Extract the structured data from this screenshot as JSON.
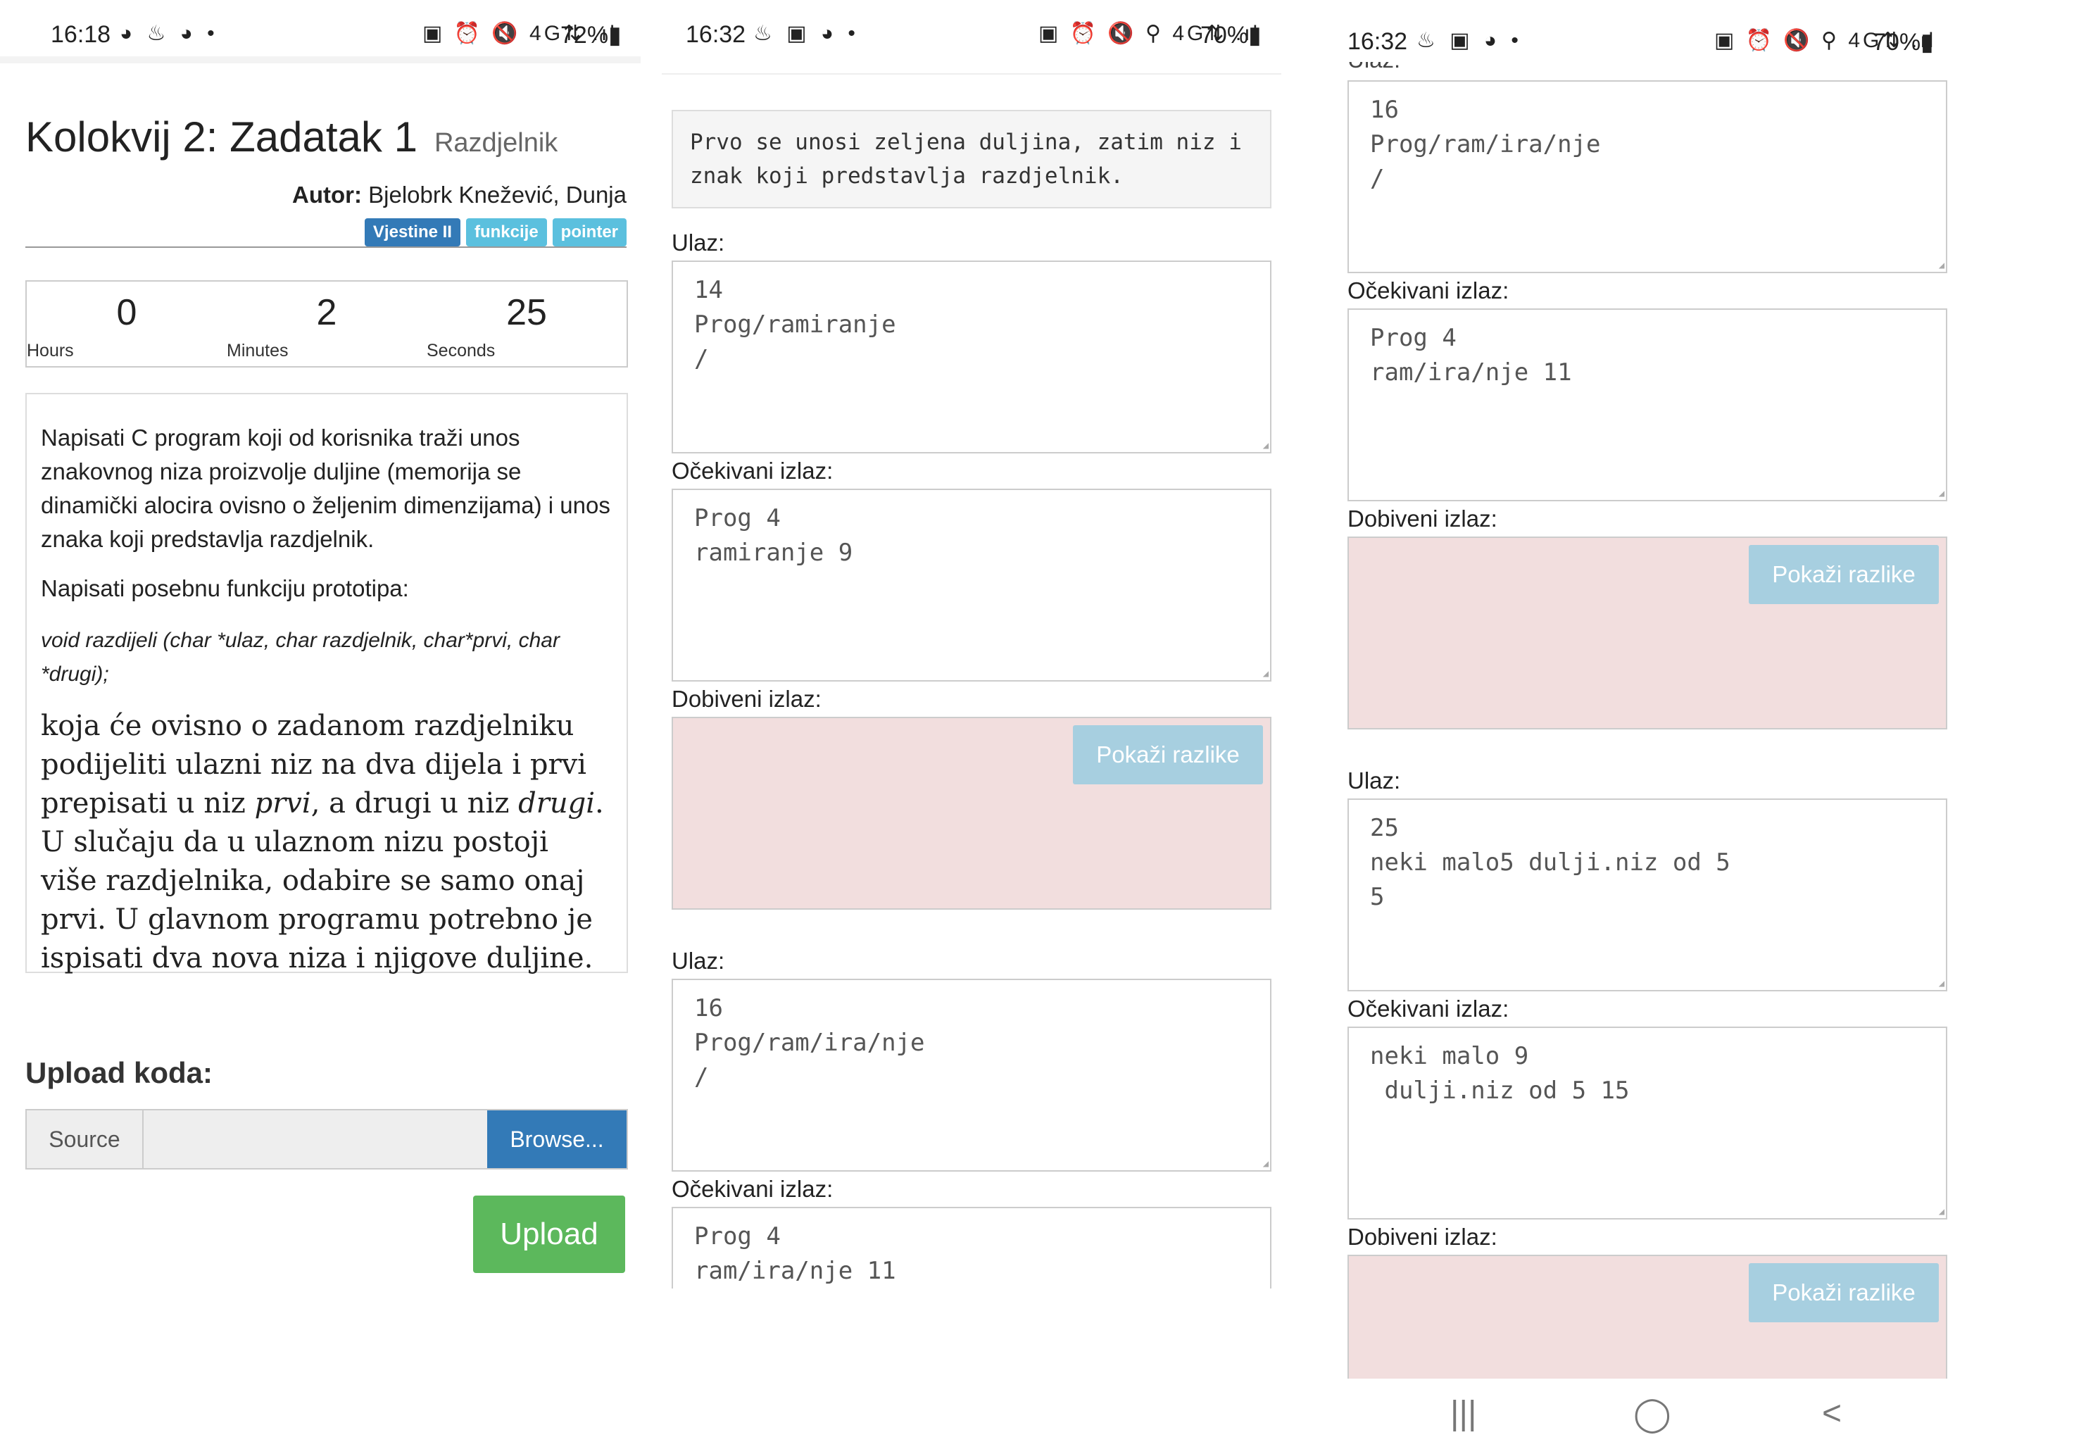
{
  "screen1": {
    "status": {
      "time": "16:18",
      "icons": "◕ ♨ ◕ •",
      "right_icons": "▣ ⏰ 🔇 4G⇅ .ıl",
      "battery": "72%▮"
    },
    "title": "Kolokvij 2: Zadatak 1",
    "subtitle": "Razdjelnik",
    "author_label": "Autor:",
    "author_name": "Bjelobrk Knežević, Dunja",
    "tags": [
      "Vjestine II",
      "funkcije",
      "pointer"
    ],
    "timer": {
      "hours": "0",
      "hours_label": "Hours",
      "minutes": "2",
      "minutes_label": "Minutes",
      "seconds": "25",
      "seconds_label": "Seconds"
    },
    "description": {
      "p1": "Napisati C program koji od korisnika traži unos znakovnog niza proizvolje duljine (memorija se dinamički alocira ovisno o željenim dimenzijama) i unos znaka koji predstavlja razdjelnik.",
      "p2": "Napisati posebnu funkciju prototipa:",
      "prototype": "void razdijeli (char *ulaz, char razdjelnik, char*prvi, char *drugi);",
      "p3_a": "koja će ovisno o zadanom razdjelniku podijeliti ulazni niz na dva dijela i prvi prepisati u niz ",
      "p3_prvi": "prvi",
      "p3_b": ", a drugi u niz ",
      "p3_drugi": "drugi",
      "p3_c": ". U slučaju da u ulaznom nizu postoji više razdjelnika, odabire se samo onaj prvi. U glavnom programu potrebno je ispisati dva nova niza i njigove duljine."
    },
    "upload_heading": "Upload koda:",
    "source_label": "Source",
    "browse_label": "Browse...",
    "upload_label": "Upload"
  },
  "screen2": {
    "status": {
      "time": "16:32",
      "icons": "♨ ▣ ◕ •",
      "right_icons": "▣ ⏰ 🔇 ⚲ 4G⇅ .ıl",
      "battery": "70%▮"
    },
    "note": "Prvo se unosi zeljena duljina, zatim niz i znak koji predstavlja razdjelnik.",
    "labels": {
      "input": "Ulaz:",
      "expected": "Očekivani izlaz:",
      "got": "Dobiveni izlaz:"
    },
    "case1": {
      "input": "14\nProg/ramiranje\n/",
      "expected": "Prog 4\nramiranje 9"
    },
    "case2": {
      "input": "16\nProg/ram/ira/nje\n/",
      "expected": "Prog 4\nram/ira/nje 11"
    },
    "diff_label": "Pokaži razlike"
  },
  "screen3": {
    "status": {
      "time": "16:32",
      "icons": "♨ ▣ ◕ •",
      "right_icons": "▣ ⏰ 🔇 ⚲ 4G⇅ .ıl",
      "battery": "70%▮"
    },
    "top_label_partial": "Ulaz:",
    "case2": {
      "input": "16\nProg/ram/ira/nje\n/",
      "expected": "Prog 4\nram/ira/nje 11"
    },
    "case3": {
      "input": "25\nneki malo5 dulji.niz od 5\n5",
      "expected": "neki malo 9\n dulji.niz od 5 15"
    },
    "labels": {
      "input": "Ulaz:",
      "expected": "Očekivani izlaz:",
      "got": "Dobiveni izlaz:"
    },
    "diff_label": "Pokaži razlike",
    "nav": {
      "recent": "|||",
      "home": "◯",
      "back": "<"
    }
  },
  "colors": {
    "primary": "#337ab7",
    "info": "#5bc0de",
    "success": "#5cb85c",
    "danger_bg": "#f2dede",
    "diff_btn": "#a7cfe0"
  }
}
